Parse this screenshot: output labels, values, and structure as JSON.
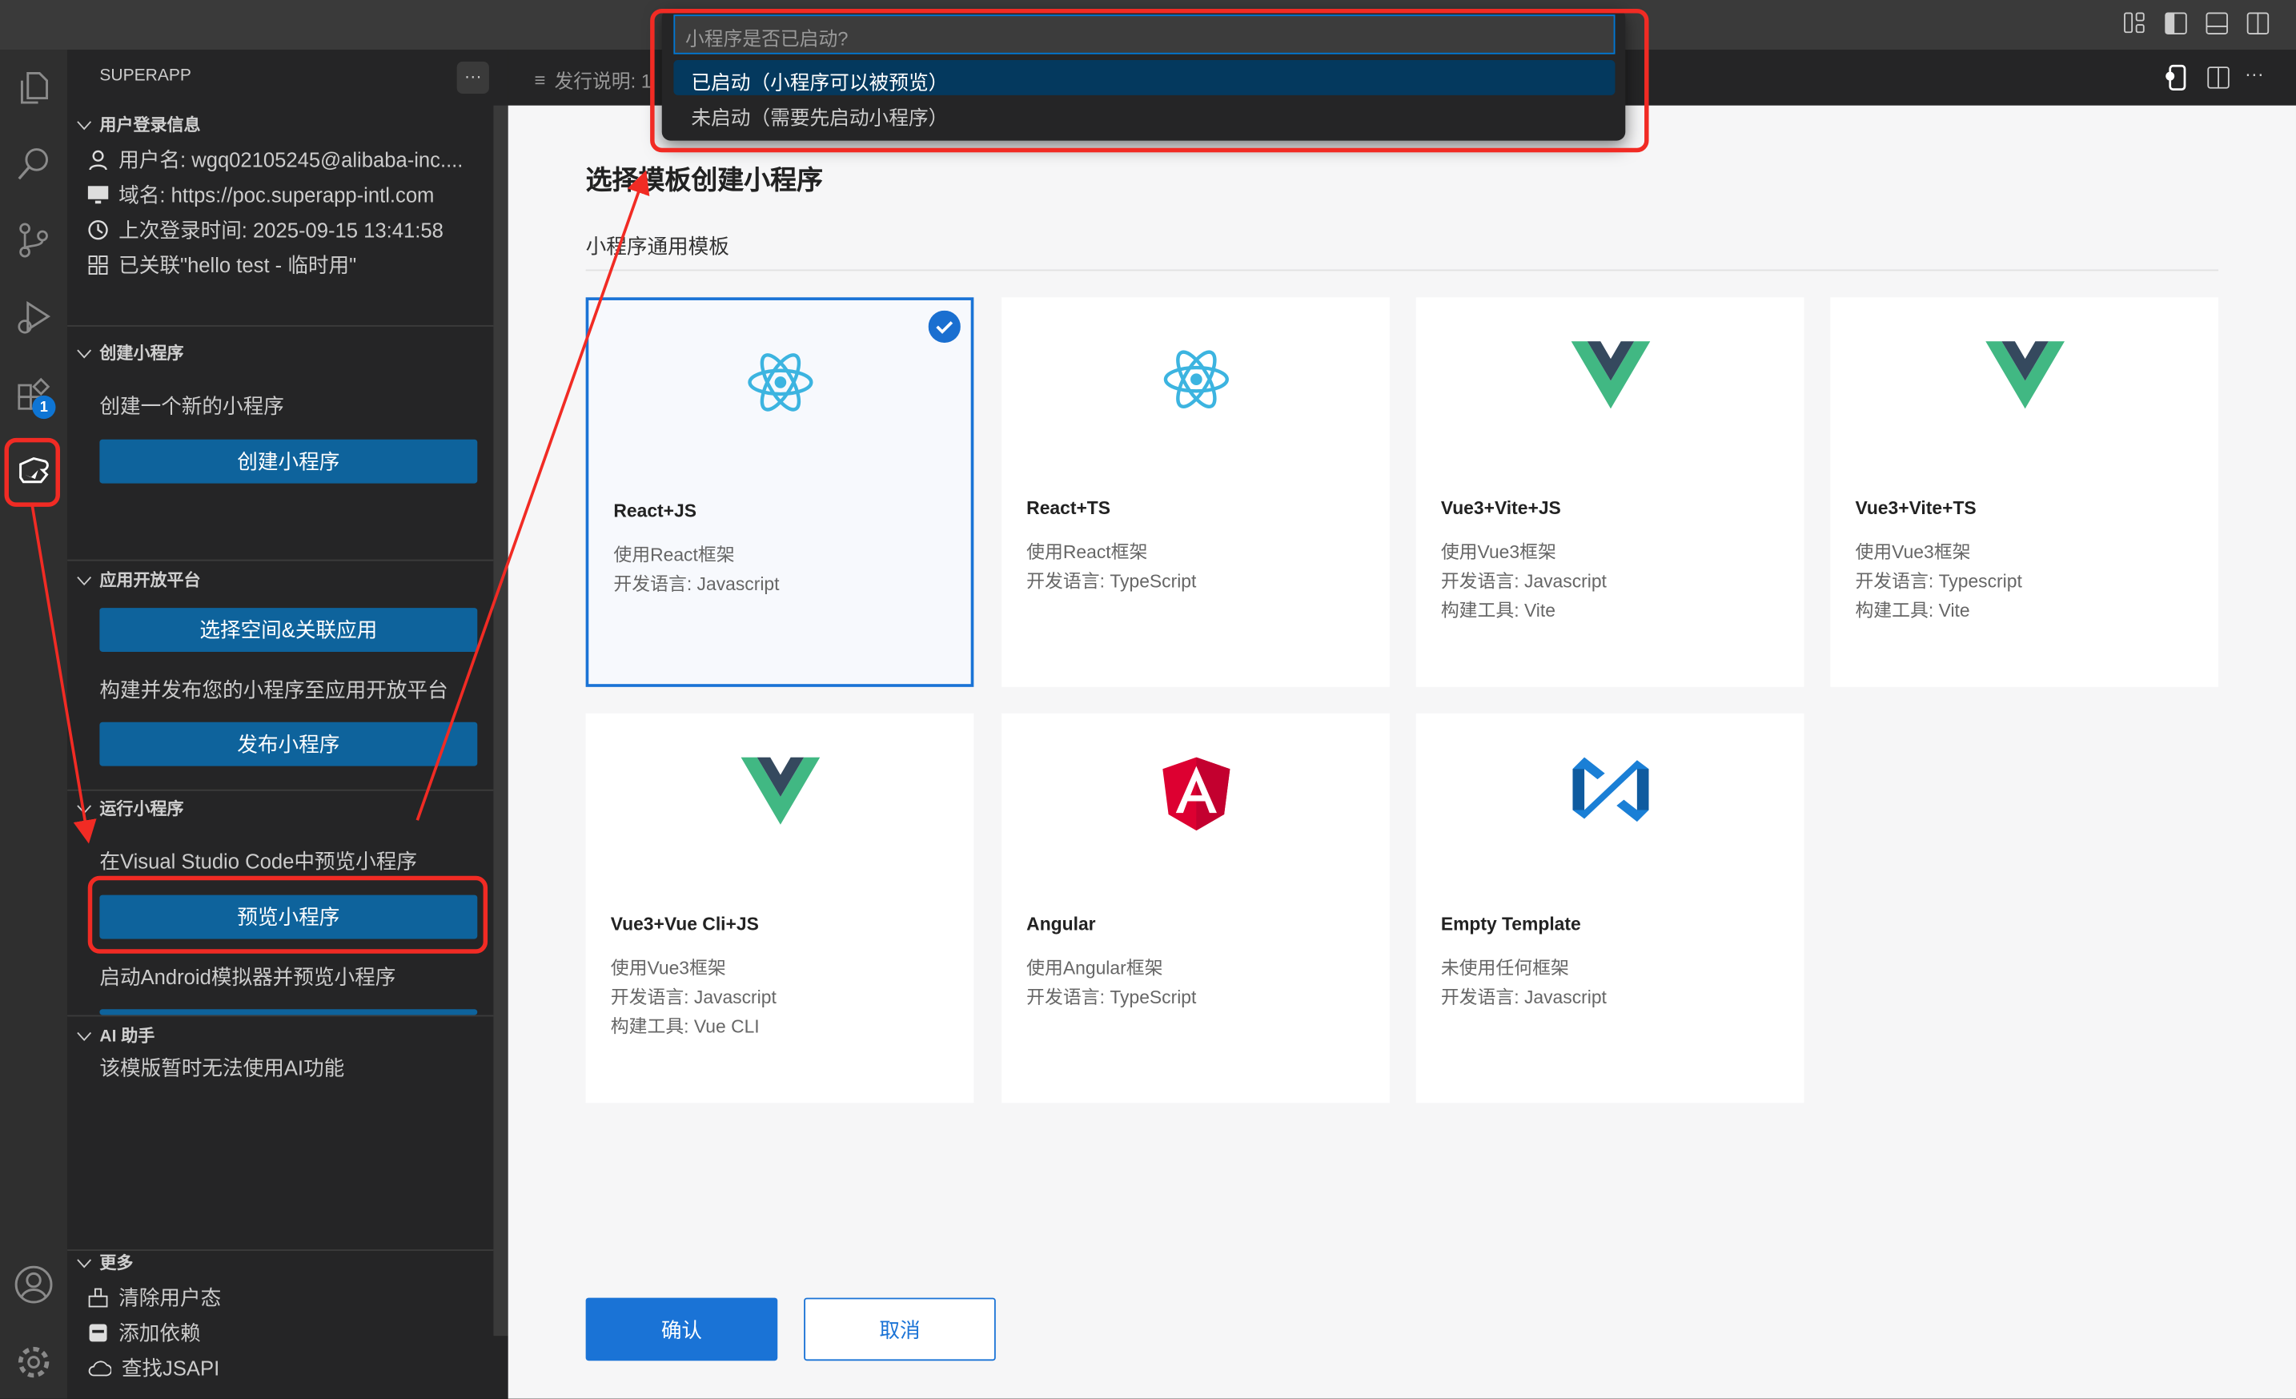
{
  "titlebar": {
    "icons": [
      "customize-layout-icon",
      "toggle-sidebar-icon",
      "toggle-panel-icon",
      "toggle-secondary-sidebar-icon"
    ]
  },
  "activity_bar": {
    "icons": [
      "explorer-icon",
      "search-icon",
      "source-control-icon",
      "run-debug-icon",
      "extensions-icon",
      "superapp-icon",
      "account-icon",
      "settings-icon"
    ],
    "extensions_badge": "1"
  },
  "sidebar": {
    "title": "SUPERAPP",
    "more": "···",
    "sections": {
      "login": {
        "header": "用户登录信息",
        "username": "用户名: wgq02105245@alibaba-inc....",
        "domain": "域名: https://poc.superapp-intl.com",
        "last_login": "上次登录时间: 2025-09-15 13:41:58",
        "linked": "已关联\"hello test - 临时用\""
      },
      "create": {
        "header": "创建小程序",
        "desc": "创建一个新的小程序",
        "button": "创建小程序"
      },
      "platform": {
        "header": "应用开放平台",
        "button1": "选择空间&关联应用",
        "desc": "构建并发布您的小程序至应用开放平台",
        "button2": "发布小程序"
      },
      "run": {
        "header": "运行小程序",
        "desc1": "在Visual Studio Code中预览小程序",
        "button": "预览小程序",
        "desc2": "启动Android模拟器并预览小程序"
      },
      "ai": {
        "header": "AI 助手",
        "desc": "该模版暂时无法使用AI功能"
      },
      "more": {
        "header": "更多",
        "items": [
          "清除用户态",
          "添加依赖",
          "查找JSAPI"
        ]
      }
    }
  },
  "tab": {
    "label": "发行说明: 1"
  },
  "quick_pick": {
    "placeholder": "小程序是否已启动?",
    "options": [
      "已启动（小程序可以被预览）",
      "未启动（需要先启动小程序）"
    ],
    "selected_index": 0
  },
  "editor": {
    "title": "选择模板创建小程序",
    "subtitle": "小程序通用模板",
    "templates": [
      {
        "name": "React+JS",
        "icon": "react-icon",
        "lines": [
          "使用React框架",
          "开发语言: Javascript"
        ],
        "selected": true
      },
      {
        "name": "React+TS",
        "icon": "react-icon",
        "lines": [
          "使用React框架",
          "开发语言: TypeScript"
        ]
      },
      {
        "name": "Vue3+Vite+JS",
        "icon": "vue-icon",
        "lines": [
          "使用Vue3框架",
          "开发语言: Javascript",
          "构建工具: Vite"
        ]
      },
      {
        "name": "Vue3+Vite+TS",
        "icon": "vue-icon",
        "lines": [
          "使用Vue3框架",
          "开发语言: Typescript",
          "构建工具: Vite"
        ]
      },
      {
        "name": "Vue3+Vue Cli+JS",
        "icon": "vue-icon",
        "lines": [
          "使用Vue3框架",
          "开发语言: Javascript",
          "构建工具: Vue CLI"
        ]
      },
      {
        "name": "Angular",
        "icon": "angular-icon",
        "lines": [
          "使用Angular框架",
          "开发语言: TypeScript"
        ]
      },
      {
        "name": "Empty Template",
        "icon": "empty-template-icon",
        "lines": [
          "未使用任何框架",
          "开发语言: Javascript"
        ]
      }
    ],
    "confirm": "确认",
    "cancel": "取消"
  },
  "colors": {
    "accent": "#1a73d6",
    "sidebar_button": "#0e639c",
    "annotation": "#f12b24",
    "quickpick_selected": "#04395e"
  }
}
